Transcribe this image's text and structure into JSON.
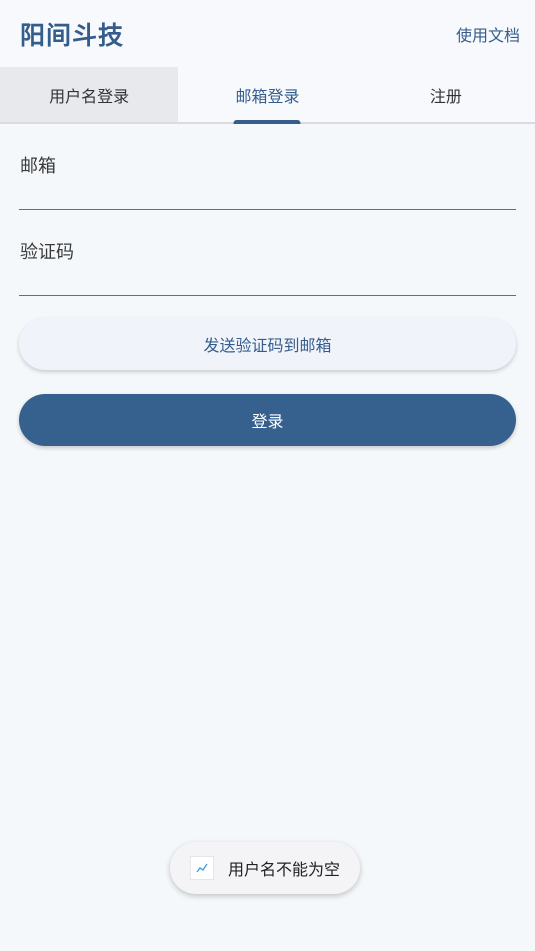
{
  "header": {
    "title": "阳间斗技",
    "docs_link": "使用文档"
  },
  "tabs": [
    {
      "label": "用户名登录",
      "active": false
    },
    {
      "label": "邮箱登录",
      "active": true
    },
    {
      "label": "注册",
      "active": false
    }
  ],
  "form": {
    "email_placeholder": "邮箱",
    "email_value": "",
    "code_placeholder": "验证码",
    "code_value": "",
    "send_code_label": "发送验证码到邮箱",
    "login_label": "登录"
  },
  "toast": {
    "icon": "trend-chart-icon",
    "message": "用户名不能为空"
  },
  "colors": {
    "primary": "#355d8c",
    "background": "#f5f8fa",
    "tab_inactive_bg": "#e7e9ec"
  }
}
